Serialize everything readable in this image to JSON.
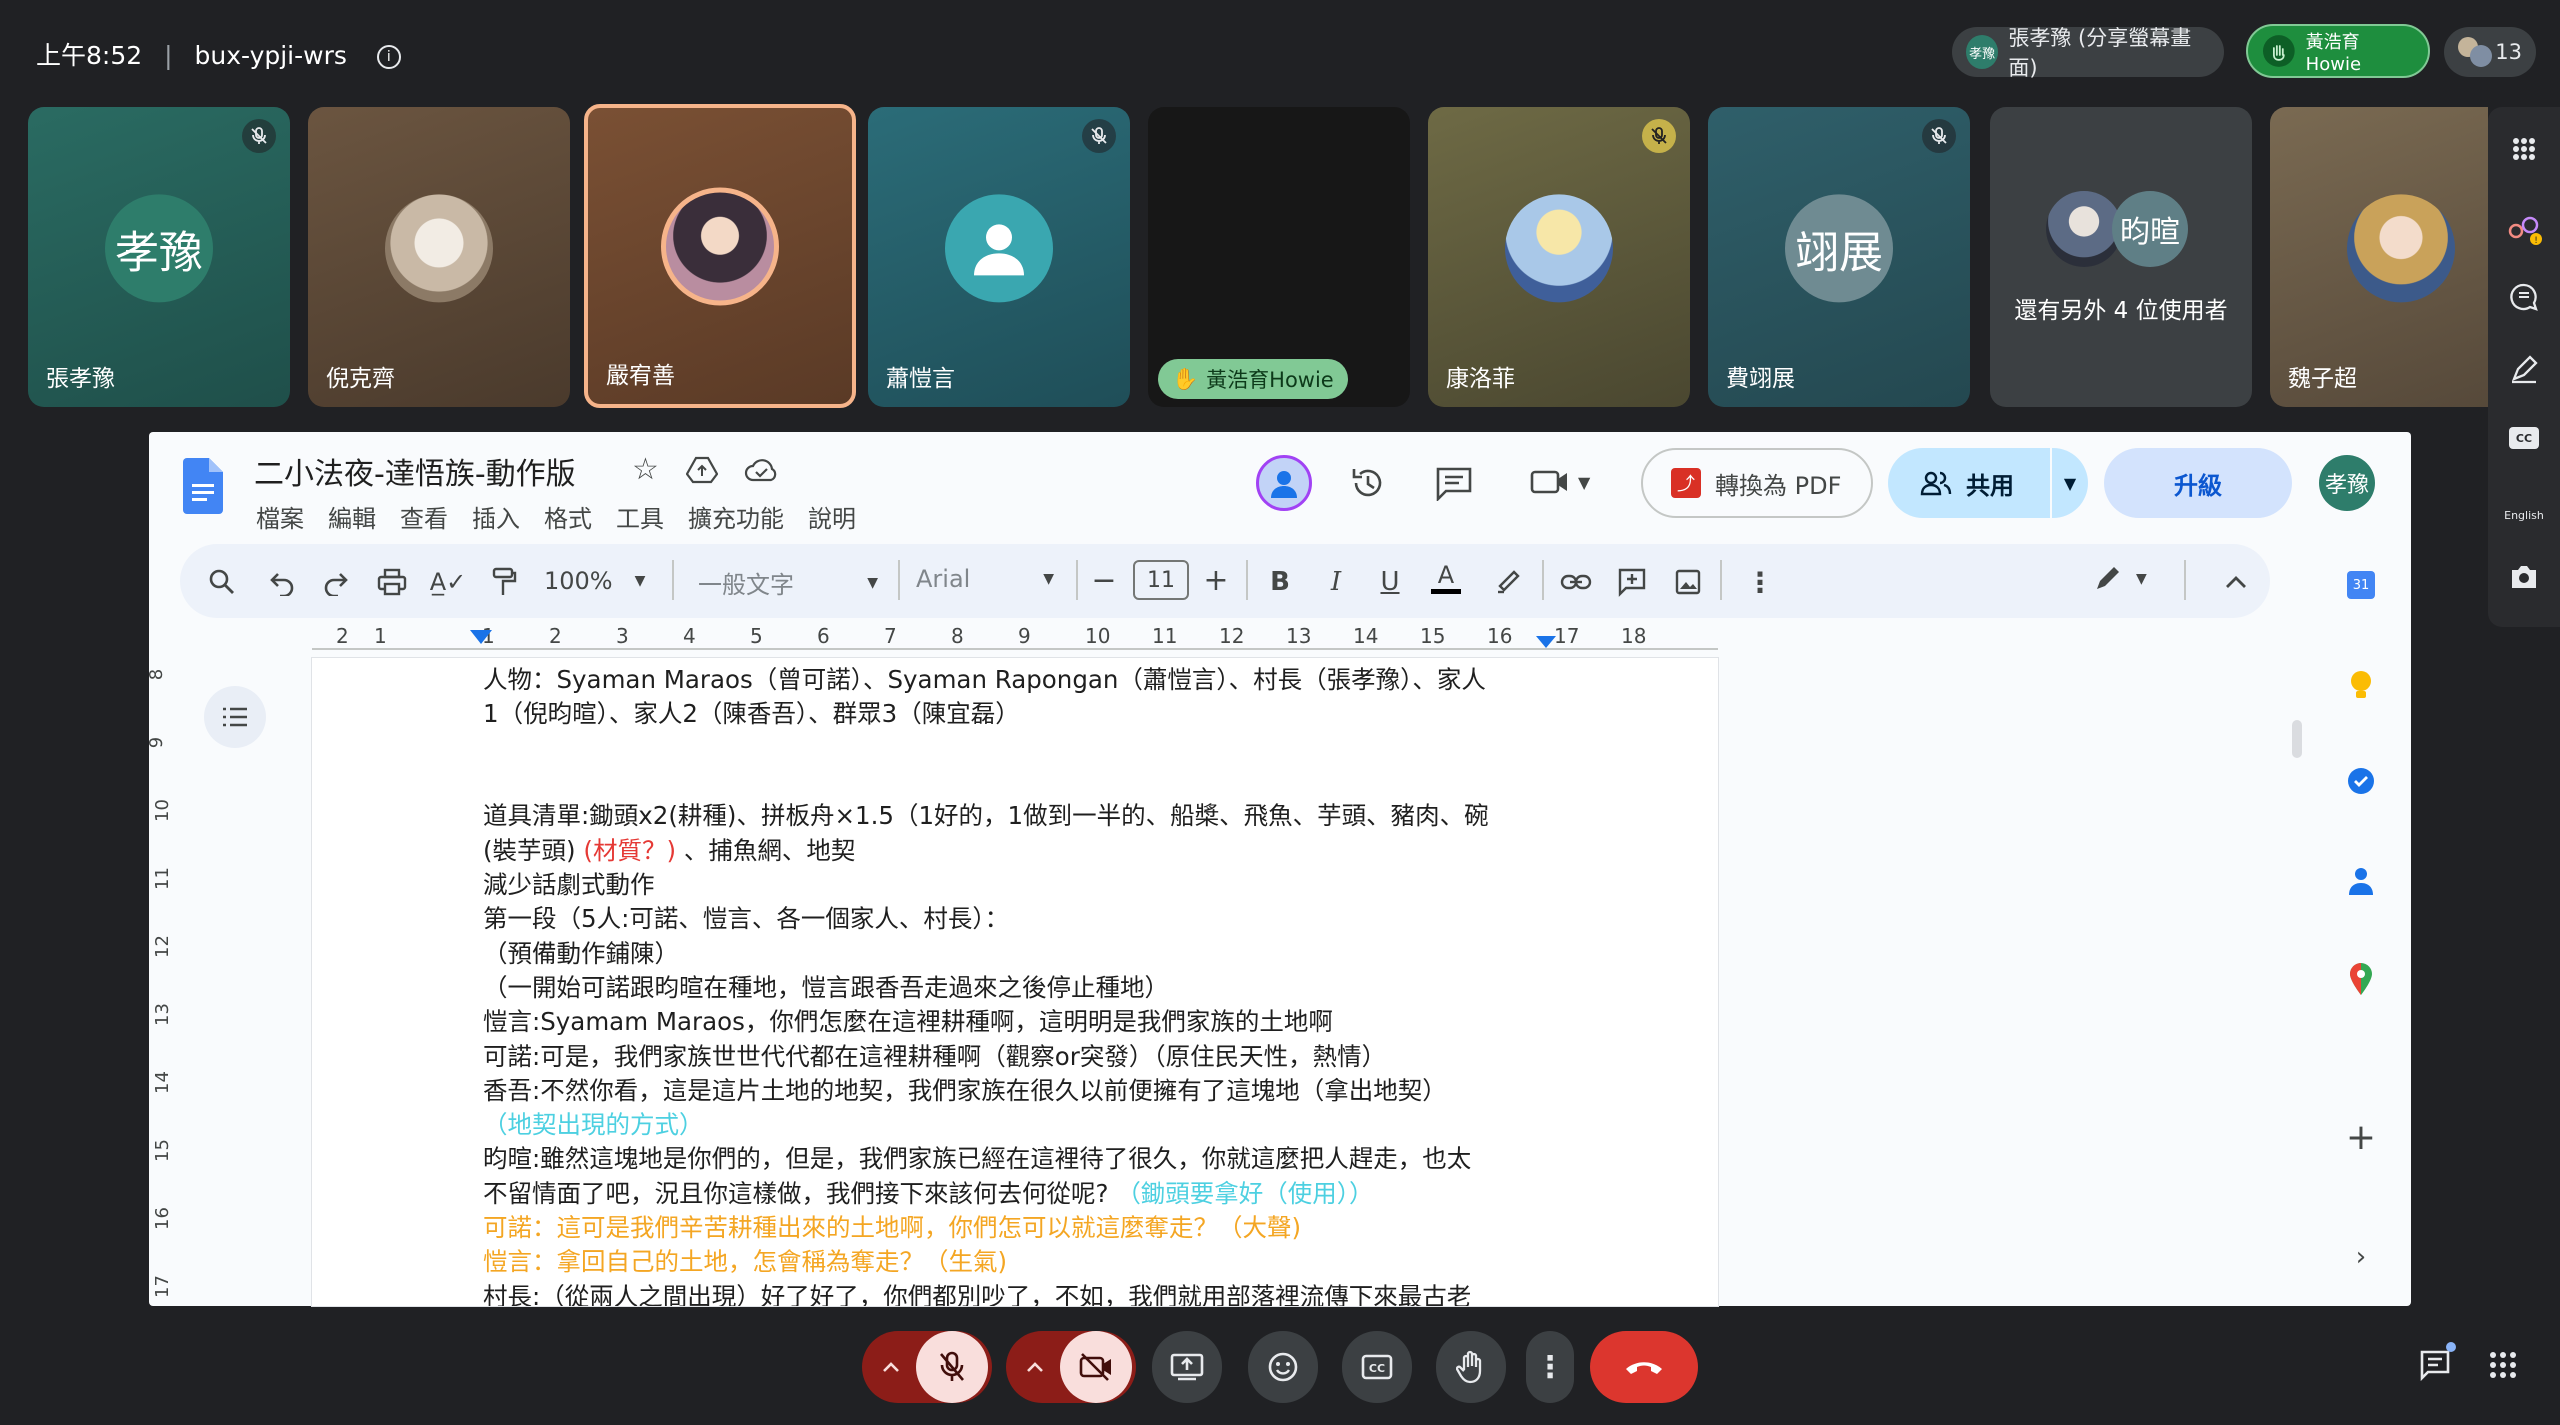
{
  "meeting": {
    "time": "上午8:52",
    "code": "bux-ypji-wrs"
  },
  "top_right": {
    "presenter_chip": {
      "avatar": "孝豫",
      "label": "張孝豫 (分享螢幕畫面)"
    },
    "raised_hand_chip": {
      "label": "黃浩育Howie"
    },
    "participants_count": "13"
  },
  "tiles": [
    {
      "name": "張孝豫",
      "avatar_text": "孝豫",
      "muted": true
    },
    {
      "name": "倪克齊",
      "avatar_text": "",
      "muted": false
    },
    {
      "name": "嚴宥善",
      "avatar_text": "",
      "muted": false,
      "speaking": true
    },
    {
      "name": "蕭愷言",
      "avatar_text": "",
      "muted": true
    },
    {
      "name": "黃浩育Howie",
      "avatar_text": "",
      "muted": false,
      "hand_raised": true
    },
    {
      "name": "康洛菲",
      "avatar_text": "",
      "muted": true
    },
    {
      "name": "費翊展",
      "avatar_text": "翊展",
      "muted": true
    },
    {
      "name": "還有另外 4 位使用者",
      "avatar_text": "昀暄",
      "muted": false
    },
    {
      "name": "魏子超",
      "avatar_text": "",
      "muted": false
    }
  ],
  "rail": {
    "caption_lang": "English"
  },
  "docs": {
    "title": "二小法夜-達悟族-動作版",
    "menus": [
      "檔案",
      "編輯",
      "查看",
      "插入",
      "格式",
      "工具",
      "擴充功能",
      "說明"
    ],
    "pdf_button": "轉換為 PDF",
    "share_button": "共用",
    "upgrade_button": "升級",
    "user_avatar": "孝豫",
    "zoom": "100%",
    "style": "一般文字",
    "font": "Arial",
    "font_size": "11",
    "ruler_numbers": [
      "2",
      "1",
      "1",
      "2",
      "3",
      "4",
      "5",
      "6",
      "7",
      "8",
      "9",
      "10",
      "11",
      "12",
      "13",
      "14",
      "15",
      "16",
      "17",
      "18"
    ],
    "vruler_numbers": [
      "8",
      "9",
      "10",
      "11",
      "12",
      "13",
      "14",
      "15",
      "16",
      "17"
    ],
    "lines": [
      {
        "text": "人物：Syaman Maraos（曾可諾）、Syaman Rapongan（蕭愷言）、村長（張孝豫）、家人",
        "color": "#1f1f1f"
      },
      {
        "text": "1（倪昀暄）、家人2（陳香吾）、群眾3（陳宜磊）",
        "color": "#1f1f1f"
      },
      {
        "text": "道具清單:鋤頭x2(耕種)、拼板舟×1.5（1好的，1做到一半的、船槳、飛魚、芋頭、豬肉、碗",
        "color": "#1f1f1f"
      },
      {
        "text": "(裝芋頭)",
        "color": "#1f1f1f"
      },
      {
        "text": "(材質？)",
        "color": "#e53935"
      },
      {
        "text": "、捕魚網、地契",
        "color": "#1f1f1f"
      },
      {
        "text": "減少話劇式動作",
        "color": "#1f1f1f"
      },
      {
        "text": "第一段（5人:可諾、愷言、各一個家人、村長）：",
        "color": "#1f1f1f"
      },
      {
        "text": "（預備動作鋪陳）",
        "color": "#1f1f1f"
      },
      {
        "text": "（一開始可諾跟昀暄在種地，愷言跟香吾走過來之後停止種地）",
        "color": "#1f1f1f"
      },
      {
        "text": "愷言:Syamam Maraos，你們怎麼在這裡耕種啊，這明明是我們家族的土地啊",
        "color": "#1f1f1f"
      },
      {
        "text": "可諾:可是，我們家族世世代代都在這裡耕種啊（觀察or突發）（原住民天性，熱情）",
        "color": "#1f1f1f"
      },
      {
        "text": "香吾:不然你看，這是這片土地的地契，我們家族在很久以前便擁有了這塊地（拿出地契）",
        "color": "#1f1f1f"
      },
      {
        "text": "（地契出現的方式）",
        "color": "#4dd0e1"
      },
      {
        "text": "昀暄:雖然這塊地是你們的，但是，我們家族已經在這裡待了很久，你就這麼把人趕走，也太",
        "color": "#1f1f1f"
      },
      {
        "text": "不留情面了吧，況且你這樣做，我們接下來該何去何從呢?",
        "color": "#1f1f1f"
      },
      {
        "text": "（鋤頭要拿好（使用））",
        "color": "#4dd0e1"
      },
      {
        "text": "可諾：這可是我們辛苦耕種出來的土地啊，你們怎可以就這麼奪走？（大聲)",
        "color": "#f4a623"
      },
      {
        "text": "愷言：拿回自己的土地，怎會稱為奪走？（生氣)",
        "color": "#f4a623"
      },
      {
        "text": "村長:（從兩人之間出現）好了好了，你們都別吵了，不如，我們就用部落裡流傳下來最古老",
        "color": "#1f1f1f"
      }
    ]
  },
  "bottom": {
    "chat_badge": true
  }
}
